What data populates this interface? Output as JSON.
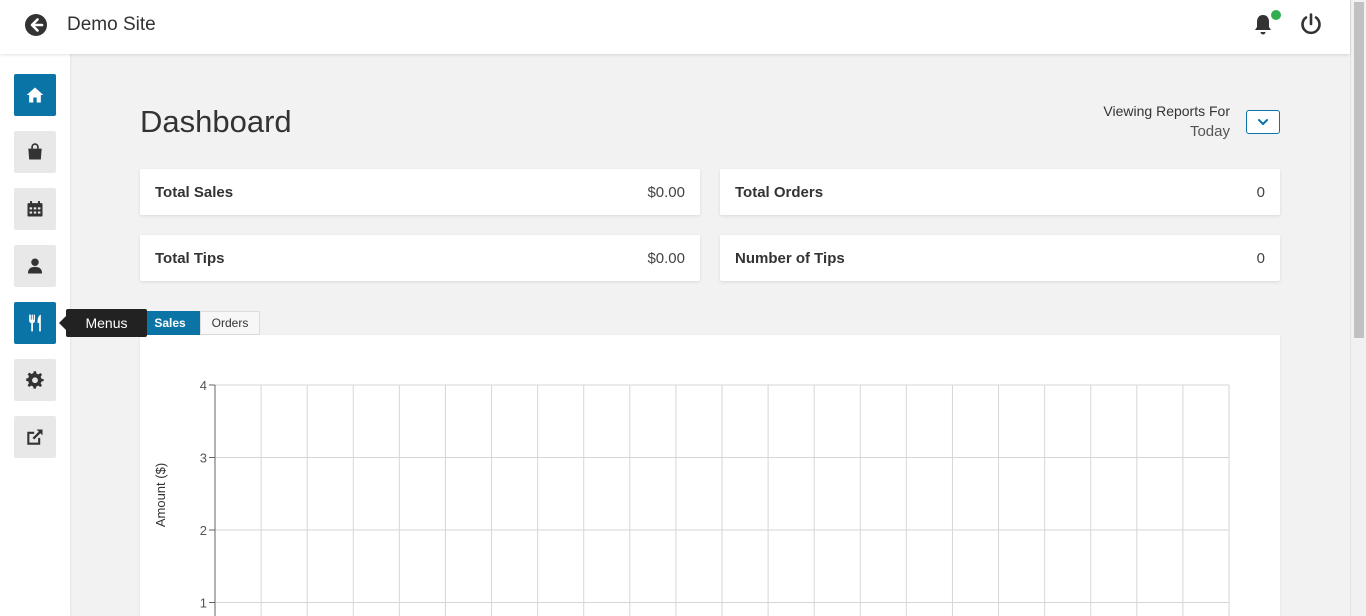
{
  "header": {
    "site_title": "Demo Site",
    "back_icon": "arrow-left-circle-icon",
    "notification_icon": "bell-icon",
    "notification_dot_color": "#2fae4f",
    "power_icon": "power-icon"
  },
  "sidebar": {
    "accent": "#0a74a6",
    "items": [
      {
        "icon": "home-icon",
        "active": true
      },
      {
        "icon": "shopping-bag-icon",
        "active": false
      },
      {
        "icon": "calendar-icon",
        "active": false
      },
      {
        "icon": "user-icon",
        "active": false
      },
      {
        "icon": "utensils-icon",
        "active": true
      },
      {
        "icon": "gear-icon",
        "active": false
      },
      {
        "icon": "external-link-icon",
        "active": false
      }
    ],
    "tooltip": "Menus"
  },
  "main": {
    "title": "Dashboard",
    "viewing_label": "Viewing Reports For",
    "viewing_value": "Today",
    "cards": [
      {
        "label": "Total Sales",
        "value": "$0.00"
      },
      {
        "label": "Total Orders",
        "value": "0"
      },
      {
        "label": "Total Tips",
        "value": "$0.00"
      },
      {
        "label": "Number of Tips",
        "value": "0"
      }
    ],
    "tabs": [
      {
        "label": "Sales",
        "active": true
      },
      {
        "label": "Orders",
        "active": false
      }
    ]
  },
  "chart_data": {
    "type": "line",
    "ylabel": "Amount ($)",
    "yticks": [
      4,
      3,
      2,
      1
    ],
    "ylim_visible": [
      1,
      4
    ],
    "vertical_gridlines": 23,
    "grid": true,
    "series": []
  }
}
